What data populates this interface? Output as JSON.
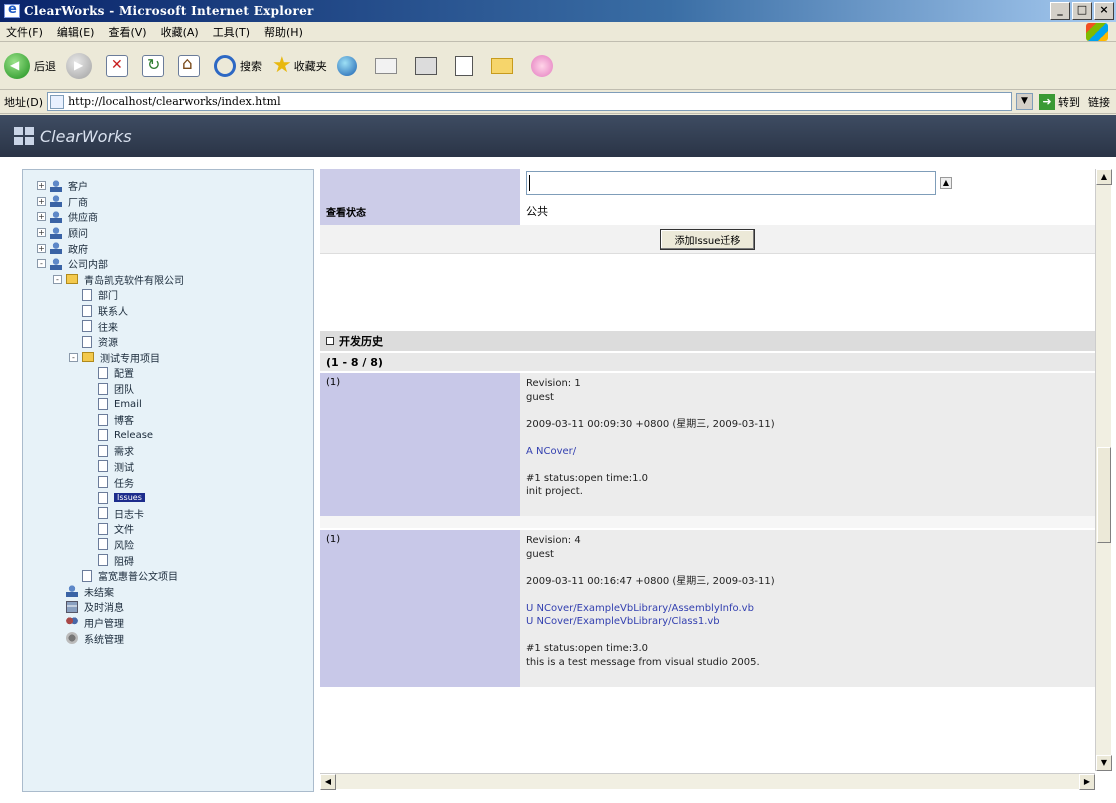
{
  "window": {
    "title": "ClearWorks - Microsoft Internet Explorer",
    "controls": [
      "_",
      "□",
      "×"
    ]
  },
  "menu": [
    "文件(F)",
    "编辑(E)",
    "查看(V)",
    "收藏(A)",
    "工具(T)",
    "帮助(H)"
  ],
  "toolbar": {
    "back_label": "后退",
    "search_label": "搜索",
    "favorites_label": "收藏夹"
  },
  "address": {
    "label": "地址(D)",
    "url": "http://localhost/clearworks/index.html",
    "go_label": "转到",
    "links_label": "链接"
  },
  "app": {
    "name": "ClearWorks"
  },
  "tree": [
    {
      "label": "客户",
      "icon": "person-icon",
      "level": 0,
      "expander": "+"
    },
    {
      "label": "厂商",
      "icon": "person-icon",
      "level": 0,
      "expander": "+"
    },
    {
      "label": "供应商",
      "icon": "person-icon",
      "level": 0,
      "expander": "+"
    },
    {
      "label": "顾问",
      "icon": "person-icon",
      "level": 0,
      "expander": "+"
    },
    {
      "label": "政府",
      "icon": "person-icon",
      "level": 0,
      "expander": "+"
    },
    {
      "label": "公司内部",
      "icon": "person-icon",
      "level": 0,
      "expander": "-"
    },
    {
      "label": "青岛凯克软件有限公司",
      "icon": "folder-icon",
      "level": 1,
      "expander": "-"
    },
    {
      "label": "部门",
      "icon": "document-icon",
      "level": 2,
      "expander": ""
    },
    {
      "label": "联系人",
      "icon": "document-icon",
      "level": 2,
      "expander": ""
    },
    {
      "label": "往来",
      "icon": "document-icon",
      "level": 2,
      "expander": ""
    },
    {
      "label": "资源",
      "icon": "document-icon",
      "level": 2,
      "expander": ""
    },
    {
      "label": "测试专用项目",
      "icon": "folder-icon",
      "level": 2,
      "expander": "-"
    },
    {
      "label": "配置",
      "icon": "document-icon",
      "level": 3,
      "expander": ""
    },
    {
      "label": "团队",
      "icon": "document-icon",
      "level": 3,
      "expander": ""
    },
    {
      "label": "Email",
      "icon": "document-icon",
      "level": 3,
      "expander": ""
    },
    {
      "label": "博客",
      "icon": "document-icon",
      "level": 3,
      "expander": ""
    },
    {
      "label": "Release",
      "icon": "document-icon",
      "level": 3,
      "expander": ""
    },
    {
      "label": "需求",
      "icon": "document-icon",
      "level": 3,
      "expander": ""
    },
    {
      "label": "测试",
      "icon": "document-icon",
      "level": 3,
      "expander": ""
    },
    {
      "label": "任务",
      "icon": "document-icon",
      "level": 3,
      "expander": ""
    },
    {
      "label": "Issues",
      "icon": "document-icon",
      "level": 3,
      "expander": "",
      "selected": true
    },
    {
      "label": "日志卡",
      "icon": "document-icon",
      "level": 3,
      "expander": ""
    },
    {
      "label": "文件",
      "icon": "document-icon",
      "level": 3,
      "expander": ""
    },
    {
      "label": "风险",
      "icon": "document-icon",
      "level": 3,
      "expander": ""
    },
    {
      "label": "阻碍",
      "icon": "document-icon",
      "level": 3,
      "expander": ""
    },
    {
      "label": "富宽惠普公文项目",
      "icon": "document-icon",
      "level": 2,
      "expander": ""
    },
    {
      "label": "未结案",
      "icon": "person-icon",
      "level": 1,
      "expander": ""
    },
    {
      "label": "及时消息",
      "icon": "server-icon",
      "level": 1,
      "expander": ""
    },
    {
      "label": "用户管理",
      "icon": "users-icon",
      "level": 1,
      "expander": ""
    },
    {
      "label": "系统管理",
      "icon": "gear-icon",
      "level": 1,
      "expander": ""
    }
  ],
  "form": {
    "status_label": "查看状态",
    "status_value": "公共",
    "add_button": "添加Issue迁移"
  },
  "history": {
    "section_title": "开发历史",
    "range": "(1 - 8 / 8)",
    "entries": [
      {
        "index": "(1)",
        "revision": "Revision: 1",
        "author": "guest",
        "date": "2009-03-11 00:09:30 +0800 (星期三, 2009-03-11)",
        "paths": [
          "A NCover/"
        ],
        "status": "#1 status:open time:1.0",
        "message": "init project."
      },
      {
        "index": "(1)",
        "revision": "Revision: 4",
        "author": "guest",
        "date": "2009-03-11 00:16:47 +0800 (星期三, 2009-03-11)",
        "paths": [
          "U NCover/ExampleVbLibrary/AssemblyInfo.vb",
          "U NCover/ExampleVbLibrary/Class1.vb"
        ],
        "status": "#1 status:open time:3.0",
        "message": "this is a test message from visual studio 2005."
      }
    ]
  }
}
